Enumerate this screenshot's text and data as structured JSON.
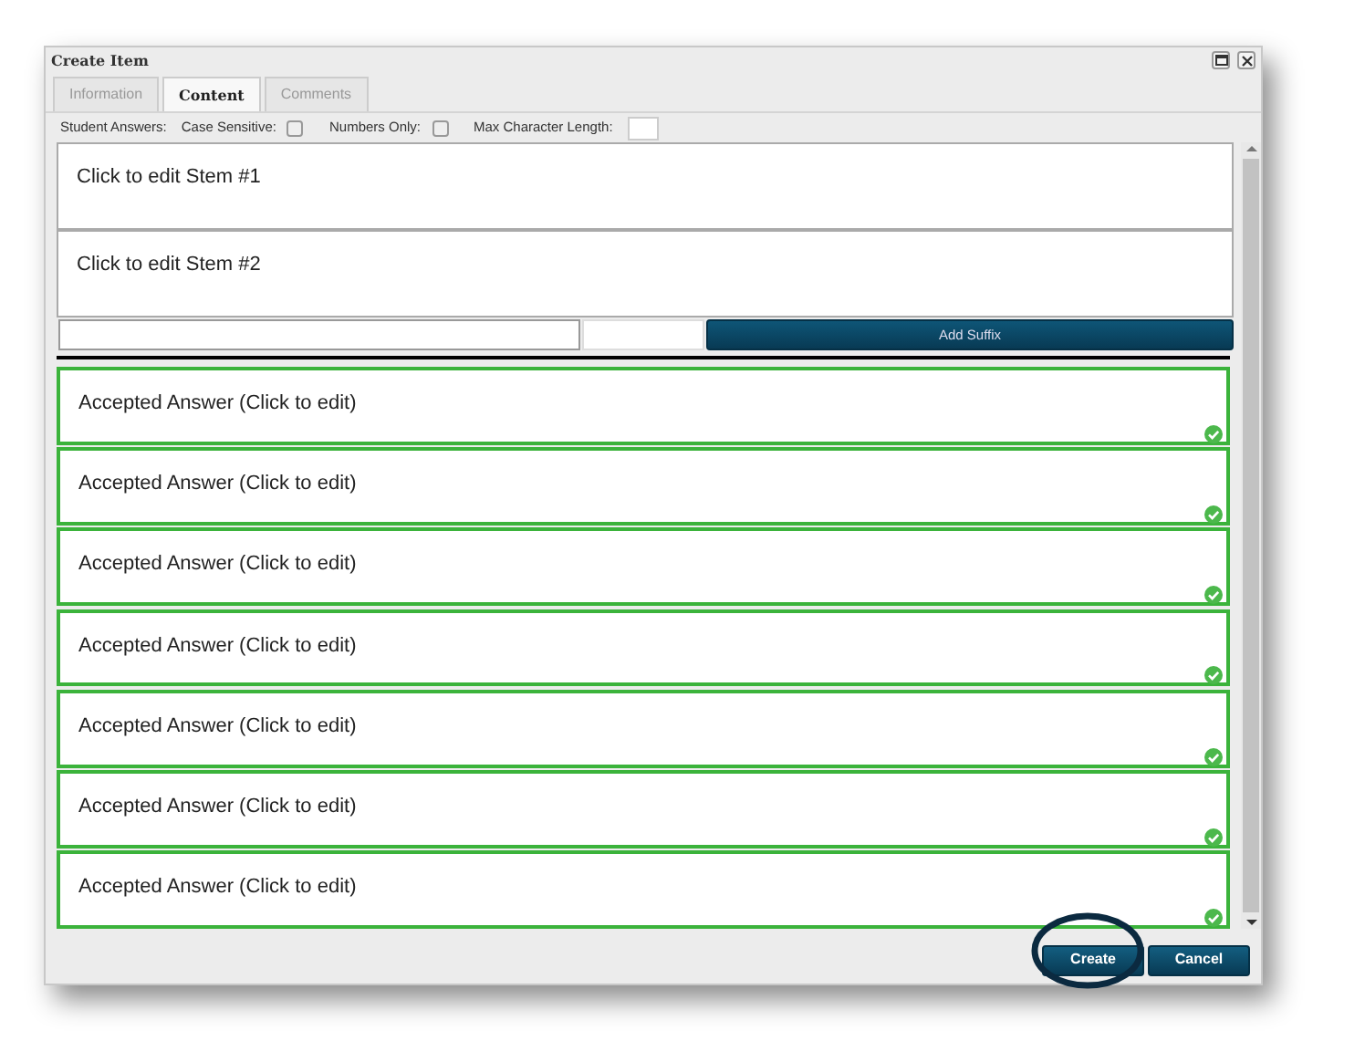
{
  "window": {
    "title": "Create Item"
  },
  "tabs": [
    {
      "label": "Information",
      "selected": false
    },
    {
      "label": "Content",
      "selected": true
    },
    {
      "label": "Comments",
      "selected": false
    }
  ],
  "options": {
    "label": "Student Answers:",
    "checks": [
      {
        "label": "Case Sensitive:",
        "checked": false
      },
      {
        "label": "Numbers Only:",
        "checked": false
      }
    ],
    "max_length": {
      "label": "Max Character Length:"
    }
  },
  "stems": [
    "Click to edit Stem #1",
    "Click to edit Stem #2"
  ],
  "suffix": {
    "button": "Add Suffix"
  },
  "answers": [
    {
      "text": "Accepted Answer (Click to edit)",
      "accepted": true
    },
    {
      "text": "Accepted Answer (Click to edit)",
      "accepted": true
    },
    {
      "text": "Accepted Answer (Click to edit)",
      "accepted": true
    },
    {
      "text": "Accepted Answer (Click to edit)",
      "accepted": true
    },
    {
      "text": "Accepted Answer (Click to edit)",
      "accepted": true
    },
    {
      "text": "Accepted Answer (Click to edit)",
      "accepted": true
    },
    {
      "text": "Accepted Answer (Click to edit)",
      "accepted": true
    }
  ],
  "buttons": [
    {
      "label": "Create",
      "highlighted": true
    },
    {
      "label": "Cancel",
      "highlighted": false
    }
  ]
}
